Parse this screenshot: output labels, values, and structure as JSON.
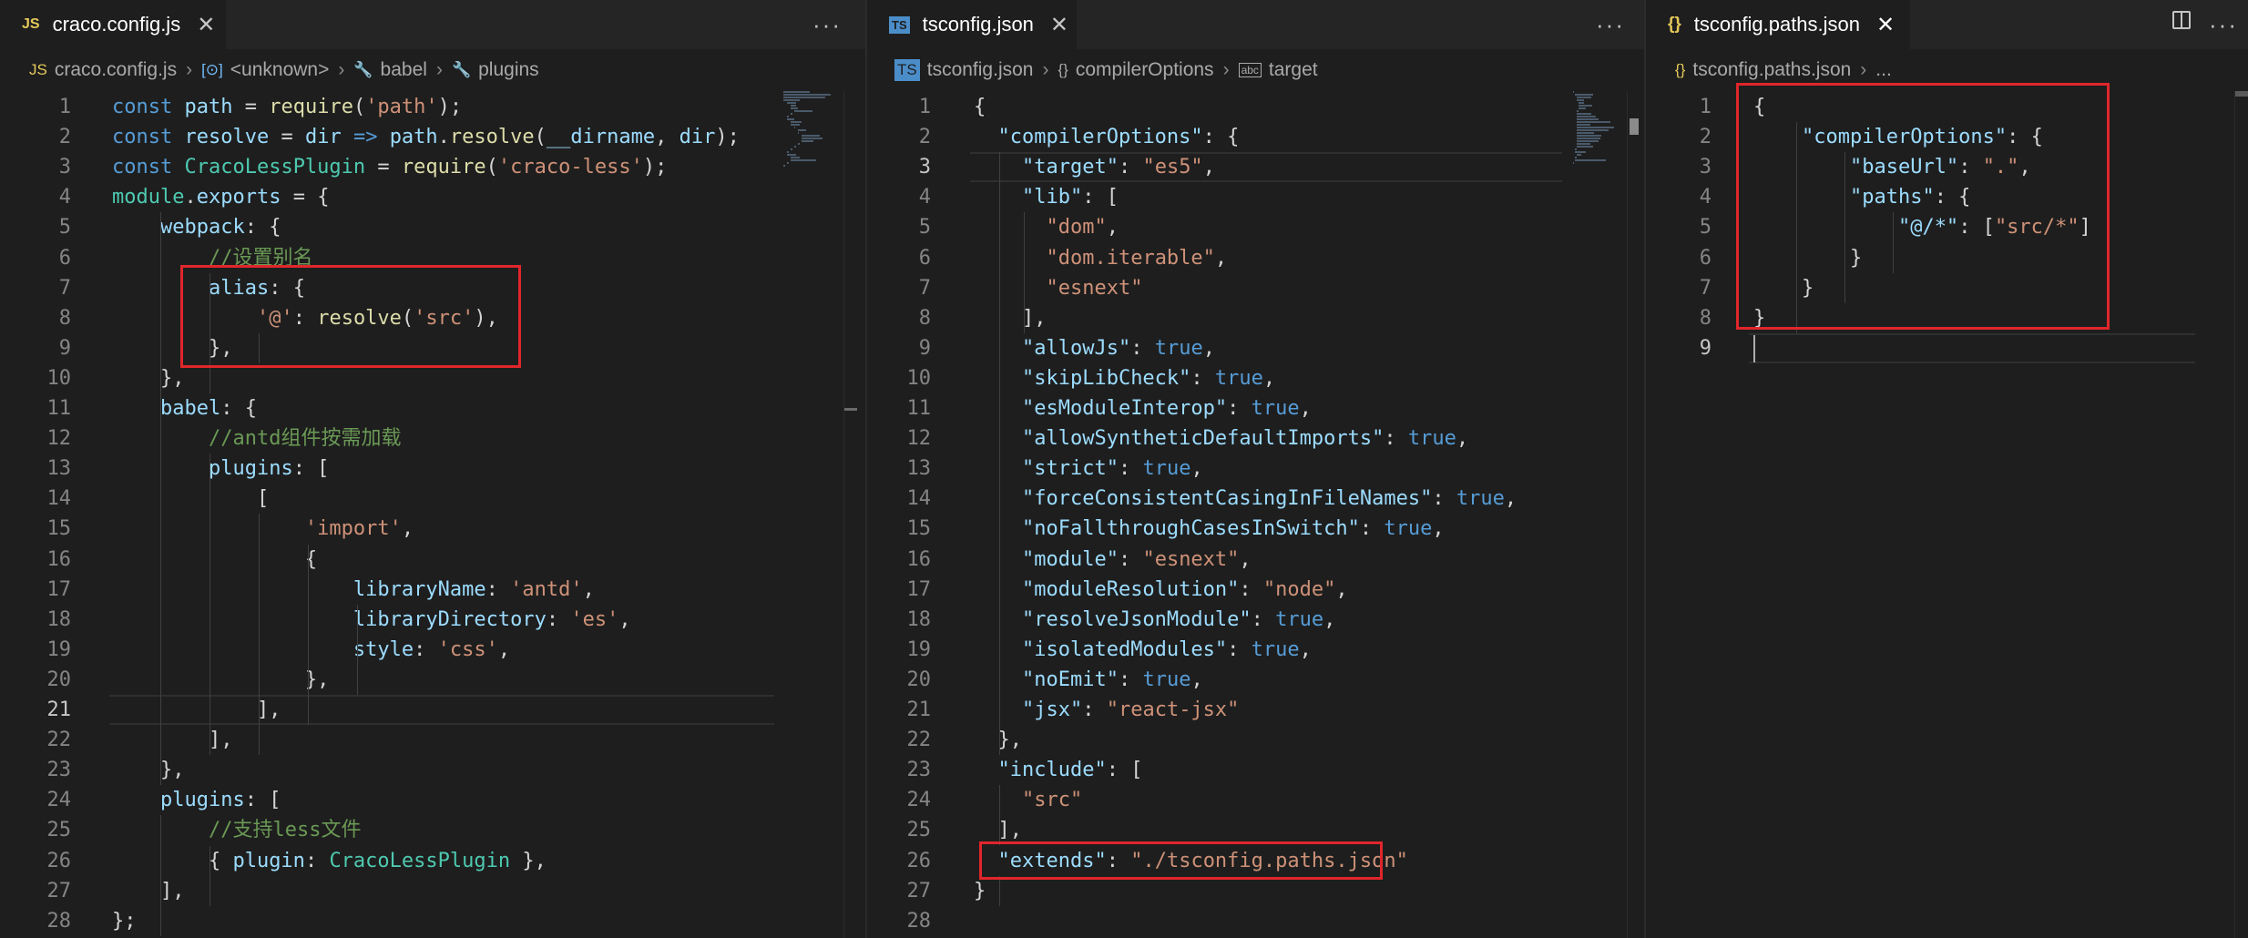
{
  "groups": [
    {
      "tab": {
        "icon": "JS",
        "label": "craco.config.js",
        "close": "✕"
      },
      "more": "···",
      "breadcrumb": [
        {
          "icon": "JS",
          "label": "craco.config.js"
        },
        {
          "icon": "[⊙]",
          "label": "<unknown>"
        },
        {
          "icon": "🔧",
          "label": "babel"
        },
        {
          "icon": "🔧",
          "label": "plugins"
        }
      ],
      "lines": [
        [
          [
            "kw",
            "const "
          ],
          [
            "var",
            "path"
          ],
          [
            "pun",
            " = "
          ],
          [
            "fn",
            "require"
          ],
          [
            "pun",
            "("
          ],
          [
            "str",
            "'path'"
          ],
          [
            "pun",
            ");"
          ]
        ],
        [
          [
            "kw",
            "const "
          ],
          [
            "var",
            "resolve"
          ],
          [
            "pun",
            " = "
          ],
          [
            "var",
            "dir"
          ],
          [
            "kw",
            " => "
          ],
          [
            "var",
            "path"
          ],
          [
            "pun",
            "."
          ],
          [
            "fn",
            "resolve"
          ],
          [
            "pun",
            "("
          ],
          [
            "var",
            "__dirname"
          ],
          [
            "pun",
            ", "
          ],
          [
            "var",
            "dir"
          ],
          [
            "pun",
            ");"
          ]
        ],
        [
          [
            "kw",
            "const "
          ],
          [
            "cls",
            "CracoLessPlugin"
          ],
          [
            "pun",
            " = "
          ],
          [
            "fn",
            "require"
          ],
          [
            "pun",
            "("
          ],
          [
            "str",
            "'craco-less'"
          ],
          [
            "pun",
            ");"
          ]
        ],
        [
          [
            "cls",
            "module"
          ],
          [
            "pun",
            "."
          ],
          [
            "var",
            "exports"
          ],
          [
            "pun",
            " = {"
          ]
        ],
        [
          [
            "pun",
            "    "
          ],
          [
            "var",
            "webpack"
          ],
          [
            "pun",
            ": {"
          ]
        ],
        [
          [
            "pun",
            "        "
          ],
          [
            "cm",
            "//设置别名"
          ]
        ],
        [
          [
            "pun",
            "        "
          ],
          [
            "var",
            "alias"
          ],
          [
            "pun",
            ": {"
          ]
        ],
        [
          [
            "pun",
            "            "
          ],
          [
            "str",
            "'@'"
          ],
          [
            "pun",
            ": "
          ],
          [
            "fn",
            "resolve"
          ],
          [
            "pun",
            "("
          ],
          [
            "str",
            "'src'"
          ],
          [
            "pun",
            "),"
          ]
        ],
        [
          [
            "pun",
            "        },"
          ]
        ],
        [
          [
            "pun",
            "    },"
          ]
        ],
        [
          [
            "pun",
            "    "
          ],
          [
            "var",
            "babel"
          ],
          [
            "pun",
            ": {"
          ]
        ],
        [
          [
            "pun",
            "        "
          ],
          [
            "cm",
            "//antd组件按需加载"
          ]
        ],
        [
          [
            "pun",
            "        "
          ],
          [
            "var",
            "plugins"
          ],
          [
            "pun",
            ": ["
          ]
        ],
        [
          [
            "pun",
            "            ["
          ]
        ],
        [
          [
            "pun",
            "                "
          ],
          [
            "str",
            "'import'"
          ],
          [
            "pun",
            ","
          ]
        ],
        [
          [
            "pun",
            "                {"
          ]
        ],
        [
          [
            "pun",
            "                    "
          ],
          [
            "var",
            "libraryName"
          ],
          [
            "pun",
            ": "
          ],
          [
            "str",
            "'antd'"
          ],
          [
            "pun",
            ","
          ]
        ],
        [
          [
            "pun",
            "                    "
          ],
          [
            "var",
            "libraryDirectory"
          ],
          [
            "pun",
            ": "
          ],
          [
            "str",
            "'es'"
          ],
          [
            "pun",
            ","
          ]
        ],
        [
          [
            "pun",
            "                    "
          ],
          [
            "var",
            "style"
          ],
          [
            "pun",
            ": "
          ],
          [
            "str",
            "'css'"
          ],
          [
            "pun",
            ","
          ]
        ],
        [
          [
            "pun",
            "                },"
          ]
        ],
        [
          [
            "pun",
            "            ],"
          ]
        ],
        [
          [
            "pun",
            "        ],"
          ]
        ],
        [
          [
            "pun",
            "    },"
          ]
        ],
        [
          [
            "pun",
            "    "
          ],
          [
            "var",
            "plugins"
          ],
          [
            "pun",
            ": ["
          ]
        ],
        [
          [
            "pun",
            "        "
          ],
          [
            "cm",
            "//支持less文件"
          ]
        ],
        [
          [
            "pun",
            "        { "
          ],
          [
            "var",
            "plugin"
          ],
          [
            "pun",
            ": "
          ],
          [
            "cls",
            "CracoLessPlugin"
          ],
          [
            "pun",
            " },"
          ]
        ],
        [
          [
            "pun",
            "    ],"
          ]
        ],
        [
          [
            "pun",
            "};"
          ]
        ]
      ],
      "current_line": 21
    },
    {
      "tab": {
        "icon": "TS",
        "label": "tsconfig.json",
        "close": "✕"
      },
      "more": "···",
      "breadcrumb": [
        {
          "icon": "TS",
          "label": "tsconfig.json"
        },
        {
          "icon": "{}",
          "label": "compilerOptions"
        },
        {
          "icon": "abc",
          "label": "target"
        }
      ],
      "lines": [
        [
          [
            "pun",
            "{"
          ]
        ],
        [
          [
            "pun",
            "  "
          ],
          [
            "key",
            "\"compilerOptions\""
          ],
          [
            "pun",
            ": {"
          ]
        ],
        [
          [
            "pun",
            "    "
          ],
          [
            "key",
            "\"target\""
          ],
          [
            "pun",
            ": "
          ],
          [
            "str",
            "\"es5\""
          ],
          [
            "pun",
            ","
          ]
        ],
        [
          [
            "pun",
            "    "
          ],
          [
            "key",
            "\"lib\""
          ],
          [
            "pun",
            ": ["
          ]
        ],
        [
          [
            "pun",
            "      "
          ],
          [
            "str",
            "\"dom\""
          ],
          [
            "pun",
            ","
          ]
        ],
        [
          [
            "pun",
            "      "
          ],
          [
            "str",
            "\"dom.iterable\""
          ],
          [
            "pun",
            ","
          ]
        ],
        [
          [
            "pun",
            "      "
          ],
          [
            "str",
            "\"esnext\""
          ]
        ],
        [
          [
            "pun",
            "    ],"
          ]
        ],
        [
          [
            "pun",
            "    "
          ],
          [
            "key",
            "\"allowJs\""
          ],
          [
            "pun",
            ": "
          ],
          [
            "bool",
            "true"
          ],
          [
            "pun",
            ","
          ]
        ],
        [
          [
            "pun",
            "    "
          ],
          [
            "key",
            "\"skipLibCheck\""
          ],
          [
            "pun",
            ": "
          ],
          [
            "bool",
            "true"
          ],
          [
            "pun",
            ","
          ]
        ],
        [
          [
            "pun",
            "    "
          ],
          [
            "key",
            "\"esModuleInterop\""
          ],
          [
            "pun",
            ": "
          ],
          [
            "bool",
            "true"
          ],
          [
            "pun",
            ","
          ]
        ],
        [
          [
            "pun",
            "    "
          ],
          [
            "key",
            "\"allowSyntheticDefaultImports\""
          ],
          [
            "pun",
            ": "
          ],
          [
            "bool",
            "true"
          ],
          [
            "pun",
            ","
          ]
        ],
        [
          [
            "pun",
            "    "
          ],
          [
            "key",
            "\"strict\""
          ],
          [
            "pun",
            ": "
          ],
          [
            "bool",
            "true"
          ],
          [
            "pun",
            ","
          ]
        ],
        [
          [
            "pun",
            "    "
          ],
          [
            "key",
            "\"forceConsistentCasingInFileNames\""
          ],
          [
            "pun",
            ": "
          ],
          [
            "bool",
            "true"
          ],
          [
            "pun",
            ","
          ]
        ],
        [
          [
            "pun",
            "    "
          ],
          [
            "key",
            "\"noFallthroughCasesInSwitch\""
          ],
          [
            "pun",
            ": "
          ],
          [
            "bool",
            "true"
          ],
          [
            "pun",
            ","
          ]
        ],
        [
          [
            "pun",
            "    "
          ],
          [
            "key",
            "\"module\""
          ],
          [
            "pun",
            ": "
          ],
          [
            "str",
            "\"esnext\""
          ],
          [
            "pun",
            ","
          ]
        ],
        [
          [
            "pun",
            "    "
          ],
          [
            "key",
            "\"moduleResolution\""
          ],
          [
            "pun",
            ": "
          ],
          [
            "str",
            "\"node\""
          ],
          [
            "pun",
            ","
          ]
        ],
        [
          [
            "pun",
            "    "
          ],
          [
            "key",
            "\"resolveJsonModule\""
          ],
          [
            "pun",
            ": "
          ],
          [
            "bool",
            "true"
          ],
          [
            "pun",
            ","
          ]
        ],
        [
          [
            "pun",
            "    "
          ],
          [
            "key",
            "\"isolatedModules\""
          ],
          [
            "pun",
            ": "
          ],
          [
            "bool",
            "true"
          ],
          [
            "pun",
            ","
          ]
        ],
        [
          [
            "pun",
            "    "
          ],
          [
            "key",
            "\"noEmit\""
          ],
          [
            "pun",
            ": "
          ],
          [
            "bool",
            "true"
          ],
          [
            "pun",
            ","
          ]
        ],
        [
          [
            "pun",
            "    "
          ],
          [
            "key",
            "\"jsx\""
          ],
          [
            "pun",
            ": "
          ],
          [
            "str",
            "\"react-jsx\""
          ]
        ],
        [
          [
            "pun",
            "  },"
          ]
        ],
        [
          [
            "pun",
            "  "
          ],
          [
            "key",
            "\"include\""
          ],
          [
            "pun",
            ": ["
          ]
        ],
        [
          [
            "pun",
            "    "
          ],
          [
            "str",
            "\"src\""
          ]
        ],
        [
          [
            "pun",
            "  ],"
          ]
        ],
        [
          [
            "pun",
            "  "
          ],
          [
            "key",
            "\"extends\""
          ],
          [
            "pun",
            ": "
          ],
          [
            "str",
            "\"./tsconfig.paths.json\""
          ]
        ],
        [
          [
            "pun",
            "}"
          ]
        ],
        []
      ],
      "current_line": 3
    },
    {
      "tab": {
        "icon": "{}",
        "label": "tsconfig.paths.json",
        "close": "✕"
      },
      "breadcrumb": [
        {
          "icon": "{}",
          "label": "tsconfig.paths.json"
        },
        {
          "icon": "",
          "label": "..."
        }
      ],
      "lines": [
        [
          [
            "pun",
            "{"
          ]
        ],
        [
          [
            "pun",
            "    "
          ],
          [
            "key",
            "\"compilerOptions\""
          ],
          [
            "pun",
            ": {"
          ]
        ],
        [
          [
            "pun",
            "        "
          ],
          [
            "key",
            "\"baseUrl\""
          ],
          [
            "pun",
            ": "
          ],
          [
            "str",
            "\".\""
          ],
          [
            "pun",
            ","
          ]
        ],
        [
          [
            "pun",
            "        "
          ],
          [
            "key",
            "\"paths\""
          ],
          [
            "pun",
            ": {"
          ]
        ],
        [
          [
            "pun",
            "            "
          ],
          [
            "key",
            "\"@/*\""
          ],
          [
            "pun",
            ": ["
          ],
          [
            "str",
            "\"src/*\""
          ],
          [
            "pun",
            "]"
          ]
        ],
        [
          [
            "pun",
            "        }"
          ]
        ],
        [
          [
            "pun",
            "    }"
          ]
        ],
        [
          [
            "pun",
            "}"
          ]
        ],
        []
      ],
      "current_line": 9
    }
  ]
}
